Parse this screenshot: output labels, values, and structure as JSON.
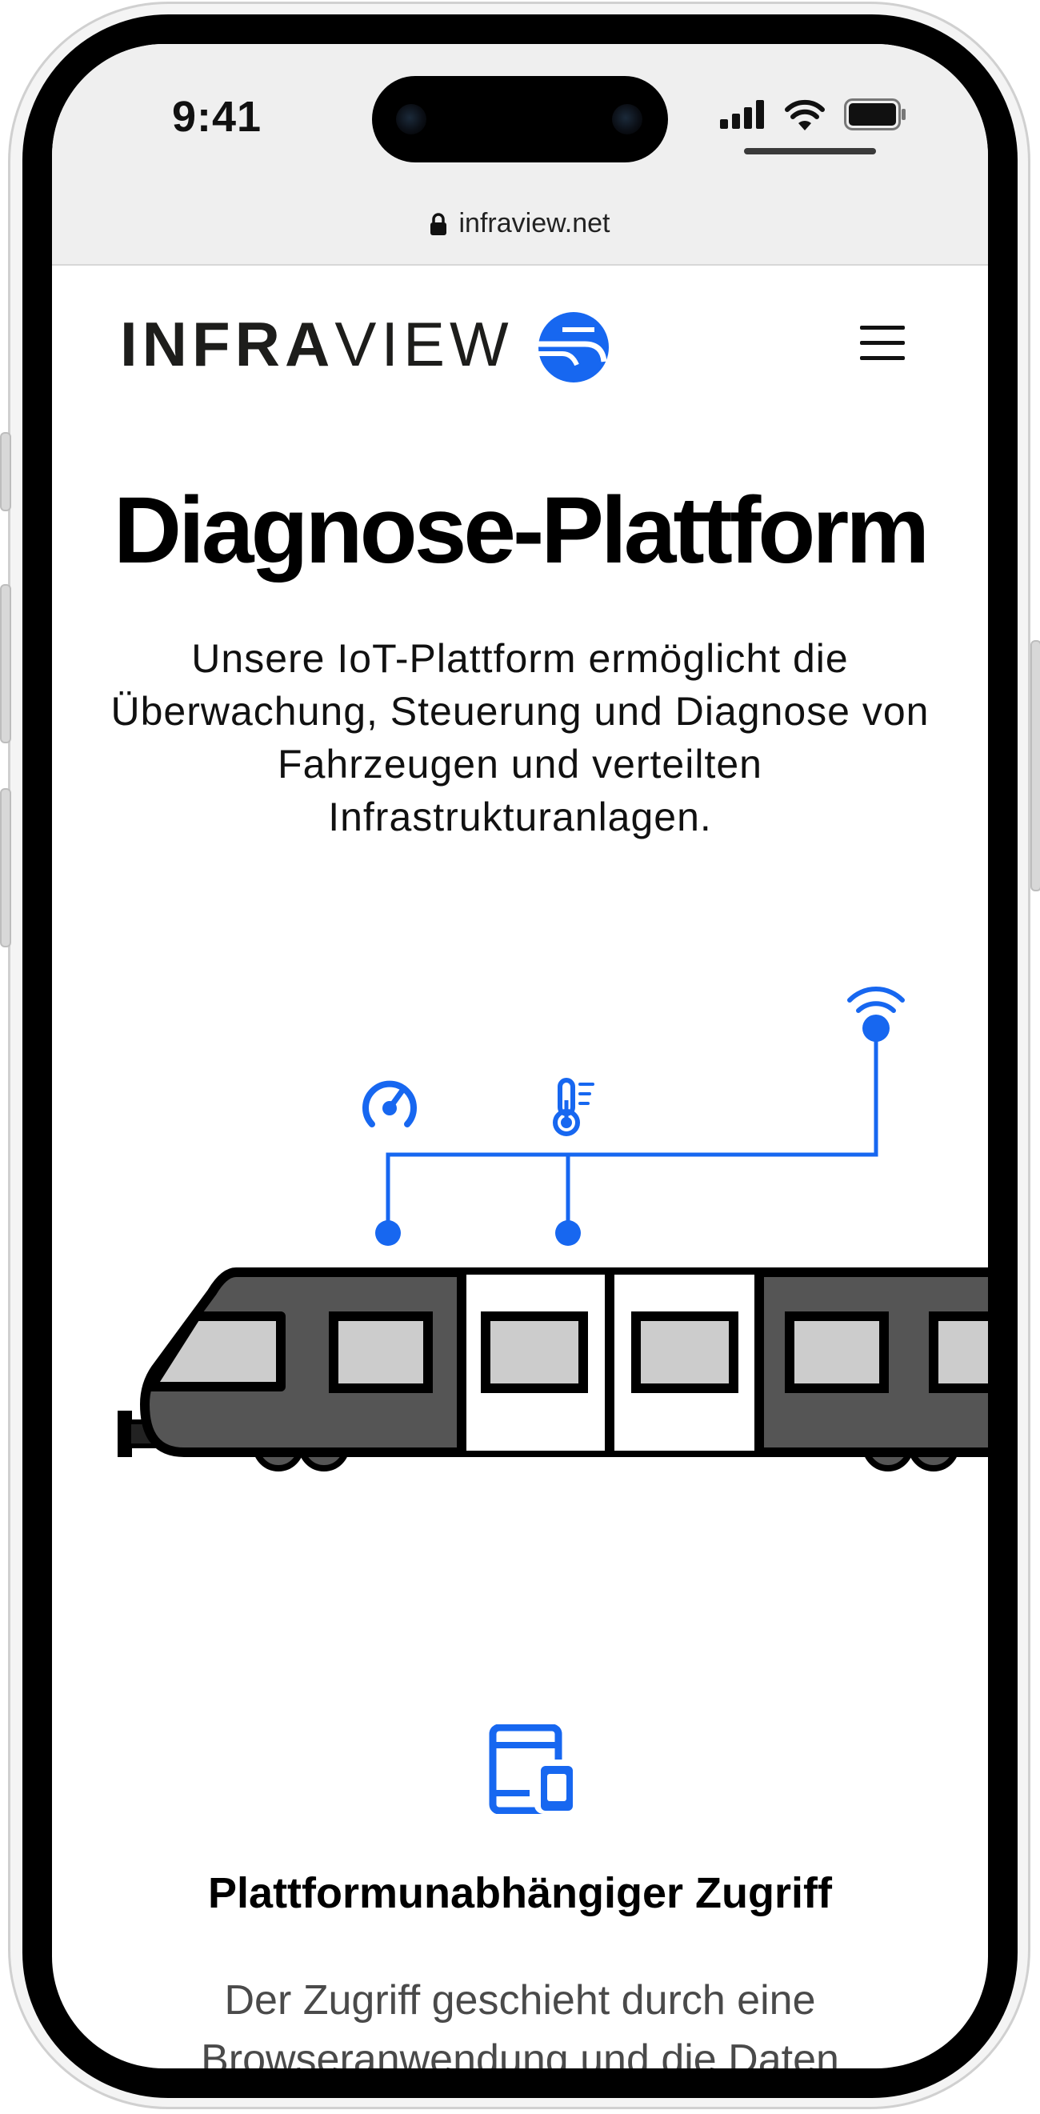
{
  "status_bar": {
    "time": "9:41",
    "url": "infraview.net"
  },
  "header": {
    "logo_bold": "INFRA",
    "logo_light": "VIEW",
    "menu_icon": "hamburger-menu-icon"
  },
  "hero": {
    "title": "Diagnose-Plattform",
    "description": "Unsere IoT-Plattform ermöglicht die Überwachung, Steuerung und Diagnose von Fahrzeugen und verteilten Infrastrukturanlagen."
  },
  "illustration": {
    "icons": [
      "gauge-icon",
      "thermometer-icon",
      "wifi-signal-icon",
      "train-icon"
    ]
  },
  "feature": {
    "icon": "devices-icon",
    "title": "Plattformunabhängiger Zugriff",
    "description": "Der Zugriff geschieht durch eine Browseranwendung und die Daten"
  },
  "colors": {
    "accent": "#1767f0",
    "train_body": "#555555",
    "train_window": "#cccccc"
  }
}
